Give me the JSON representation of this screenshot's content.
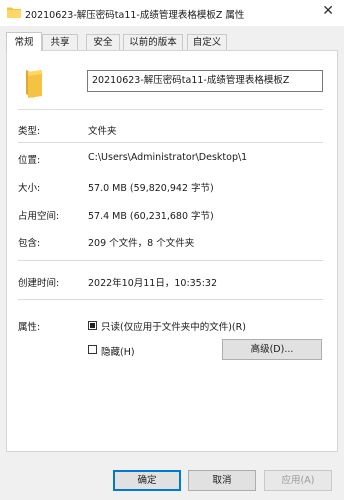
{
  "window": {
    "title": "20210623-解压密码ta11-成绩管理表格模板Z 属性",
    "close_glyph": "✕"
  },
  "tabs": [
    {
      "label": "常规",
      "active": true
    },
    {
      "label": "共享",
      "active": false
    },
    {
      "label": "安全",
      "active": false
    },
    {
      "label": "以前的版本",
      "active": false
    },
    {
      "label": "自定义",
      "active": false
    }
  ],
  "general": {
    "name": "20210623-解压密码ta11-成绩管理表格模板Z",
    "type_label": "类型:",
    "type_value": "文件夹",
    "location_label": "位置:",
    "location_value": "C:\\Users\\Administrator\\Desktop\\1",
    "size_label": "大小:",
    "size_value": "57.0 MB (59,820,942 字节)",
    "size_on_disk_label": "占用空间:",
    "size_on_disk_value": "57.4 MB (60,231,680 字节)",
    "contains_label": "包含:",
    "contains_value": "209 个文件，8 个文件夹",
    "created_label": "创建时间:",
    "created_value": "2022年10月11日，10:35:32",
    "attributes_label": "属性:",
    "readonly_label": "只读(仅应用于文件夹中的文件)(R)",
    "readonly_checked": true,
    "hidden_label": "隐藏(H)",
    "hidden_checked": false,
    "advanced_label": "高级(D)..."
  },
  "footer": {
    "ok_label": "确定",
    "cancel_label": "取消",
    "apply_label": "应用(A)"
  },
  "colors": {
    "folder": "#f5c342",
    "accent": "#0078d7"
  }
}
